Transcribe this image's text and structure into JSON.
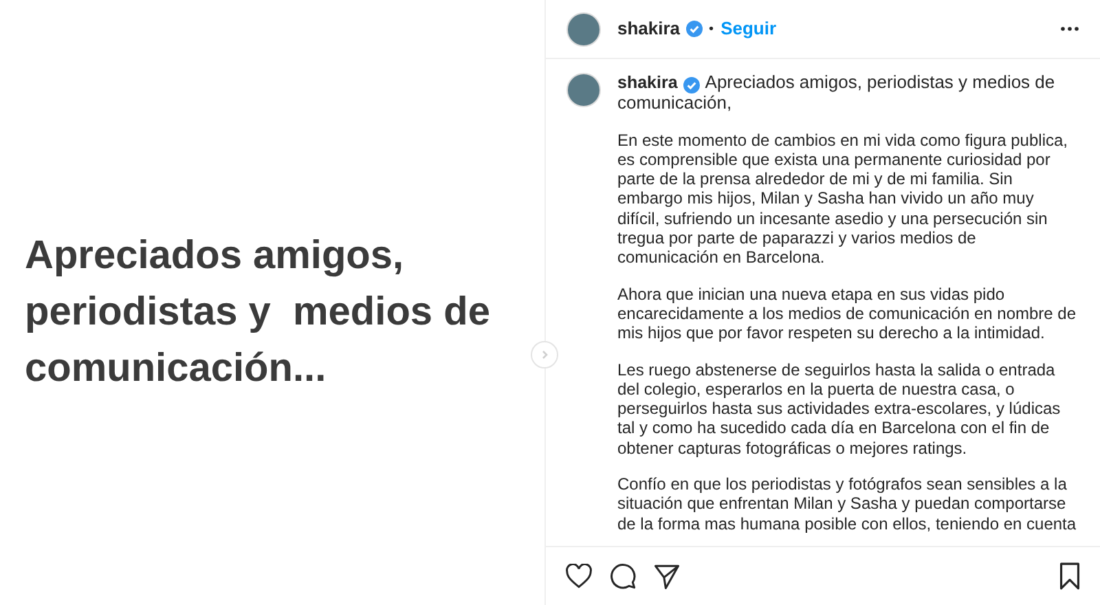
{
  "slide": {
    "text": "Apreciados amigos, periodistas y  medios de comunicación..."
  },
  "header": {
    "username": "shakira",
    "verified": true,
    "separator": "•",
    "follow_label": "Seguir"
  },
  "caption": {
    "username": "shakira",
    "verified": true,
    "paragraphs": [
      "Apreciados amigos, periodistas y medios de comunicación,",
      "En este momento de cambios en mi vida como figura publica, es comprensible que exista una permanente curiosidad por parte de la prensa alrededor de mi y de mi familia. Sin embargo mis hijos, Milan y Sasha han vivido un año muy difícil, sufriendo un incesante asedio y una persecución sin tregua por parte de paparazzi y varios medios de comunicación en Barcelona.",
      "Ahora que inician una nueva etapa en sus vidas pido encarecidamente a los medios de comunicación en nombre de mis hijos que por favor respeten su derecho a la intimidad.",
      "Les ruego abstenerse de seguirlos hasta la salida o entrada del colegio, esperarlos en la puerta de nuestra casa, o perseguirlos hasta sus actividades extra-escolares, y lúdicas tal y como ha sucedido cada día en Barcelona con el fin de obtener capturas fotográficas o mejores ratings.",
      "Confío en que los periodistas y fotógrafos sean sensibles a la situación que enfrentan Milan y Sasha y puedan comportarse de la forma mas humana posible con ellos, teniendo en cuenta"
    ]
  }
}
